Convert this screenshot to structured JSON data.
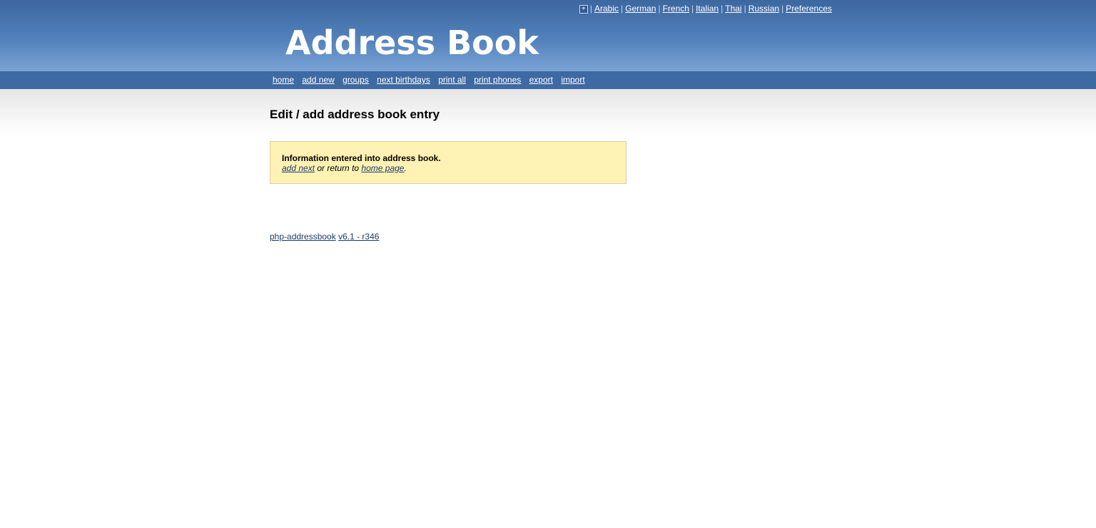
{
  "header": {
    "logo_text": "Address Book",
    "lang_toggle": "+",
    "languages": [
      "Arabic",
      "German",
      "French",
      "Italian",
      "Thai",
      "Russian"
    ],
    "preferences": "Preferences"
  },
  "nav": {
    "items": [
      "home",
      "add new",
      "groups",
      "next birthdays",
      "print all",
      "print phones",
      "export",
      "import"
    ]
  },
  "main": {
    "title": "Edit / add address book entry",
    "message": {
      "headline": "Information entered into address book.",
      "add_next_link": "add next",
      "middle_text": " or return to ",
      "home_link": "home page",
      "end_text": "."
    }
  },
  "footer": {
    "app_link": "php-addressbook",
    "version_link": "v6.1 - r346"
  },
  "colors": {
    "header_top": "#3c67a0",
    "header_bottom": "#79a3d5",
    "nav_bar": "#3e6aa3",
    "message_bg": "#fff2b4",
    "link_dark": "#1a3d66"
  }
}
